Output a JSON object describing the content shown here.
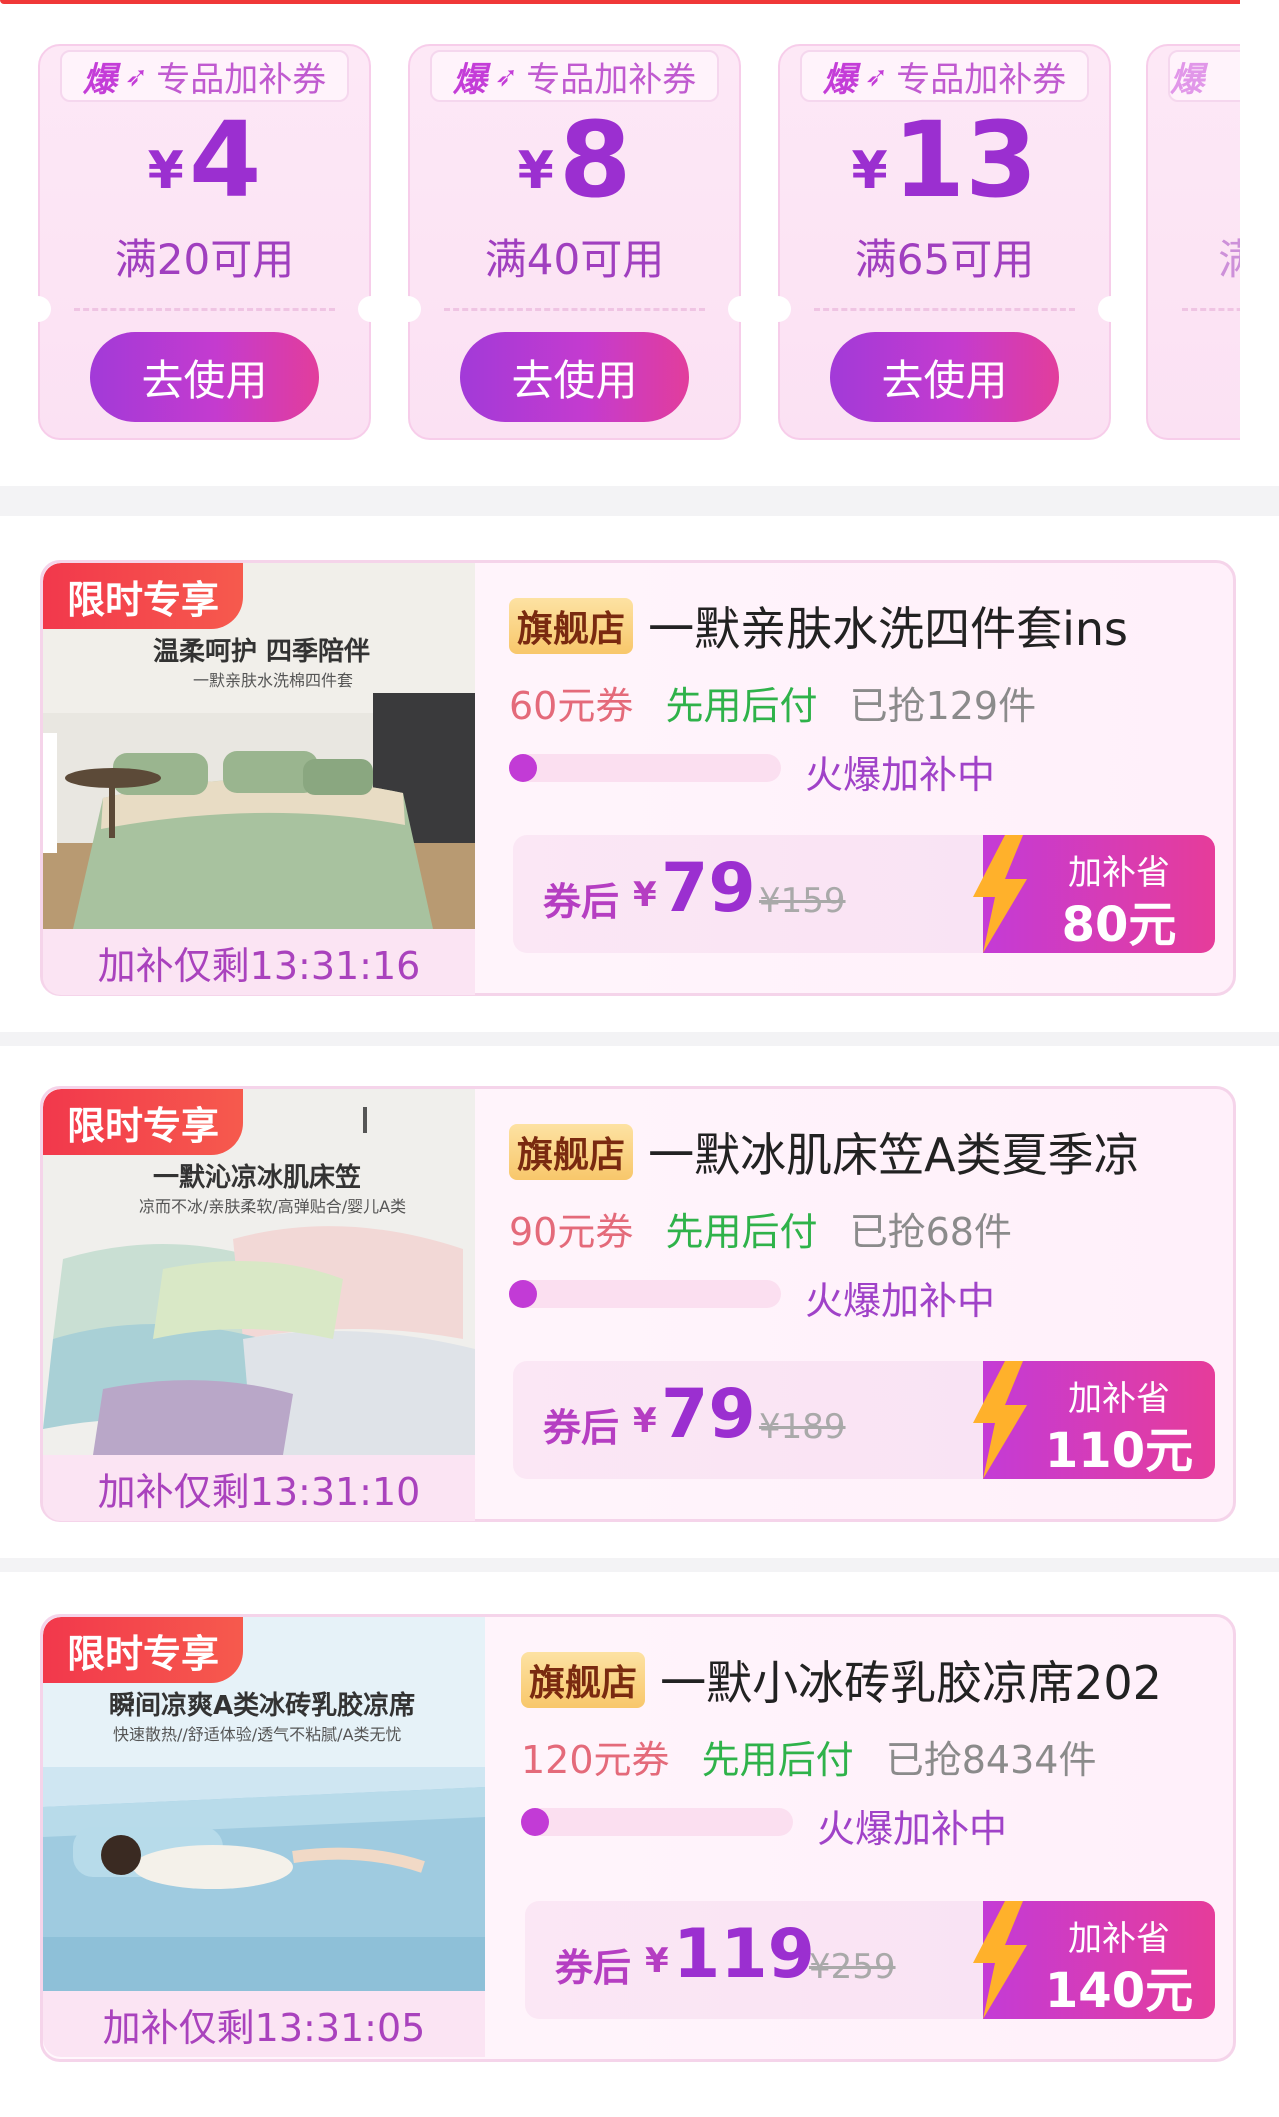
{
  "coupons": [
    {
      "tag_prefix": "爆",
      "tag_label": "专品加补券",
      "currency": "¥",
      "amount": "4",
      "condition": "满20可用",
      "button": "去使用"
    },
    {
      "tag_prefix": "爆",
      "tag_label": "专品加补券",
      "currency": "¥",
      "amount": "8",
      "condition": "满40可用",
      "button": "去使用"
    },
    {
      "tag_prefix": "爆",
      "tag_label": "专品加补券",
      "currency": "¥",
      "amount": "13",
      "condition": "满65可用",
      "button": "去使用"
    },
    {
      "tag_prefix": "爆",
      "tag_label": "",
      "currency": "¥",
      "amount": "",
      "condition": "满",
      "button": ""
    }
  ],
  "products": [
    {
      "badge": "限时专享",
      "image_title": "温柔呵护 四季陪伴",
      "image_sub": "一默亲肤水洗棉四件套",
      "store": "旗舰店",
      "title": "一默亲肤水洗四件套ins",
      "coupon": "60元券",
      "pay_later": "先用后付",
      "sold": "已抢129件",
      "progress_label": "火爆加补中",
      "progress": 0.08,
      "price_label": "券后",
      "currency": "¥",
      "price": "79",
      "original_price": "¥159",
      "save_label": "加补省",
      "save_amount": "80元",
      "timer": "加补仅剩13:31:16"
    },
    {
      "badge": "限时专享",
      "image_title": "一默沁凉冰肌床笠",
      "image_sub": "凉而不冰/亲肤柔软/高弹贴合/婴儿A类",
      "store": "旗舰店",
      "title": "一默冰肌床笠A类夏季凉",
      "coupon": "90元券",
      "pay_later": "先用后付",
      "sold": "已抢68件",
      "progress_label": "火爆加补中",
      "progress": 0.08,
      "price_label": "券后",
      "currency": "¥",
      "price": "79",
      "original_price": "¥189",
      "save_label": "加补省",
      "save_amount": "110元",
      "timer": "加补仅剩13:31:10"
    },
    {
      "badge": "限时专享",
      "image_title": "瞬间凉爽A类冰砖乳胶凉席",
      "image_sub": "快速散热//舒适体验/透气不粘腻/A类无忧",
      "store": "旗舰店",
      "title": "一默小冰砖乳胶凉席202",
      "coupon": "120元券",
      "pay_later": "先用后付",
      "sold": "已抢8434件",
      "progress_label": "火爆加补中",
      "progress": 0.08,
      "price_label": "券后",
      "currency": "¥",
      "price": "119",
      "original_price": "¥259",
      "save_label": "加补省",
      "save_amount": "140元",
      "timer": "加补仅剩13:31:05"
    }
  ],
  "colors": {
    "accent_purple": "#9b2fd0",
    "badge_red": "#f2384c",
    "pay_green": "#2fb24a",
    "coupon_pink": "#e46a7a"
  }
}
